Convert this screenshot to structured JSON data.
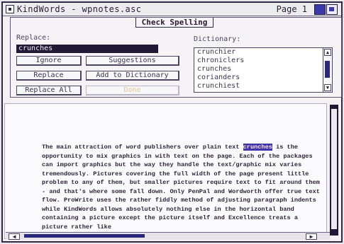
{
  "window": {
    "title": "KindWords - wpnotes.asc",
    "page_label": "Page 1"
  },
  "dialog": {
    "title": "Check Spelling",
    "replace_label": "Replace:",
    "replace_value": "crunches",
    "dictionary_label": "Dictionary:",
    "buttons": {
      "ignore": "Ignore",
      "suggestions": "Suggestions",
      "replace": "Replace",
      "add_to_dictionary": "Add to Dictionary",
      "replace_all": "Replace All",
      "done": "Done"
    },
    "dictionary_items": [
      "crunchier",
      "chroniclers",
      "crunches",
      "corianders",
      "crunchiest"
    ]
  },
  "document": {
    "before_highlight": "The main attraction of word publishers over plain text ",
    "highlight": "crunches",
    "after_highlight": " is the opportunity to mix graphics in with text on the page. Each of the packages can import graphics but the way they handle the text/graphic mix varies tremendously. Pictures covering the full width of the page present little problem to any of them, but smaller pictures require text to fit around them - and that's where some fall down. Only PenPal and Wordworth offer true text flow. ProWrite uses the rather fiddly method of adjusting paragraph indents while KindWords allows absolutely nothing else in the horizontal band containing a picture except the picture itself and Excellence treats a picture rather like"
  }
}
